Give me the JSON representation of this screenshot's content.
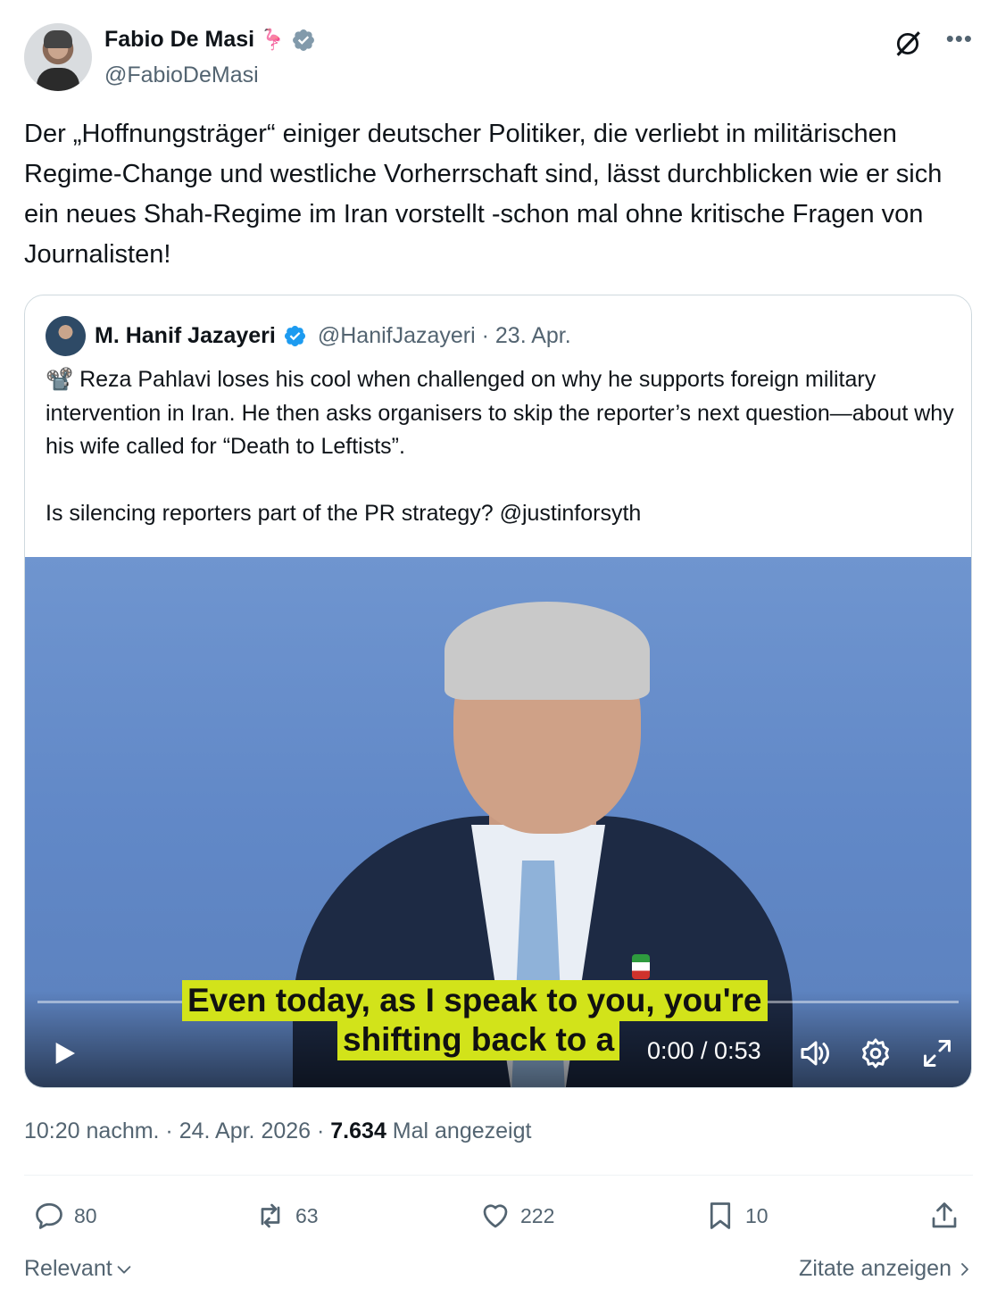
{
  "author": {
    "display_name": "Fabio De Masi",
    "emoji": "🦩",
    "handle": "@FabioDeMasi",
    "verified_color": "#829aab"
  },
  "tweet": {
    "text": "Der „Hoffnungsträger“ einiger deutscher Politiker, die verliebt in militärischen Regime-Change und westliche Vorherrschaft sind, lässt durchblicken wie er sich ein neues Shah-Regime im Iran vorstellt -schon mal ohne kritische Fragen von Journalisten!"
  },
  "quoted": {
    "display_name": "M. Hanif Jazayeri",
    "handle_date": "@HanifJazayeri · 23. Apr.",
    "text": "📽️ Reza Pahlavi loses his cool when challenged on why he supports foreign military intervention in Iran. He then asks organisers to skip the reporter’s next question—about why his wife called for “Death to Leftists”.\n\nIs silencing reporters part of the PR strategy? @justinforsyth",
    "verified_color": "#1d9bf0"
  },
  "video": {
    "subtitle_line1": "Even today, as I speak to you, you're",
    "subtitle_line2": "shifting back to a",
    "time": "0:00 / 0:53",
    "progress": 0
  },
  "meta": {
    "time_date": "10:20 nachm. · 24. Apr. 2026 · ",
    "views": "7.634",
    "views_label": " Mal angezeigt"
  },
  "actions": {
    "replies": "80",
    "reposts": "63",
    "likes": "222",
    "bookmarks": "10"
  },
  "footer": {
    "sort_label": "Relevant",
    "quotes_label": "Zitate anzeigen"
  },
  "icons": [
    "grok-icon",
    "more-icon",
    "verified-icon",
    "play-icon",
    "volume-icon",
    "settings-icon",
    "fullscreen-icon",
    "reply-icon",
    "repost-icon",
    "like-icon",
    "bookmark-icon",
    "share-icon",
    "chevron-down-icon",
    "chevron-right-icon"
  ]
}
